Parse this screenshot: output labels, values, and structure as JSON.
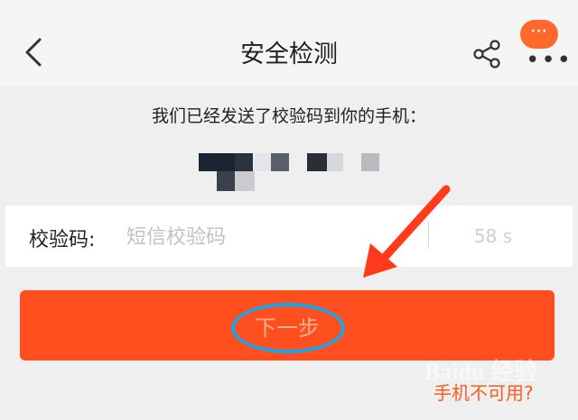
{
  "nav": {
    "title": "安全检测",
    "back_icon": "chevron-left-icon",
    "share_icon": "share-icon",
    "more_icon": "more-icon",
    "bubble_text": "···"
  },
  "notice": "我们已经发送了校验码到你的手机：",
  "verify": {
    "label": "校验码:",
    "placeholder": "短信校验码",
    "countdown": "58 s"
  },
  "next_button": {
    "label": "下一步"
  },
  "phone_unavailable_link": "手机不可用?",
  "watermark": "Baidu 经验",
  "colors": {
    "accent": "#ff4f1e",
    "highlight_circle": "#1da4e6",
    "annotation_arrow": "#ff3b1a",
    "link": "#ff5a1f"
  }
}
